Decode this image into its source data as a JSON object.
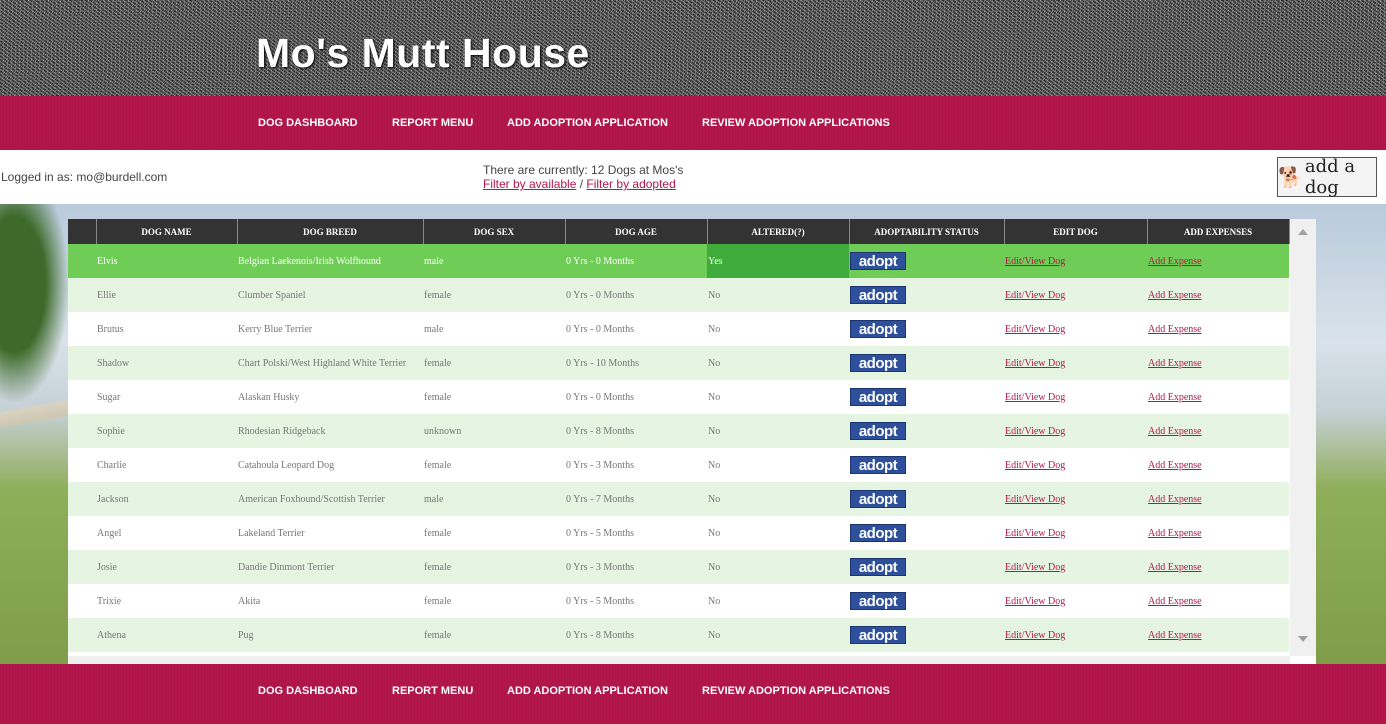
{
  "site": {
    "title": "Mo's Mutt House"
  },
  "nav": {
    "items": [
      "DOG DASHBOARD",
      "REPORT MENU",
      "ADD ADOPTION APPLICATION",
      "REVIEW ADOPTION APPLICATIONS"
    ]
  },
  "info": {
    "logged_in": "Logged in as: mo@burdell.com",
    "dog_count": "There are currently: 12 Dogs at Mos's",
    "filter_available": "Filter by available",
    "filter_separator": " / ",
    "filter_adopted": "Filter by adopted",
    "add_dog_label": "add a dog"
  },
  "table": {
    "headers": [
      "DOG NAME",
      "DOG BREED",
      "DOG SEX",
      "DOG AGE",
      "ALTERED(?)",
      "ADOPTABILITY STATUS",
      "EDIT DOG",
      "ADD EXPENSES"
    ],
    "adopt_label": "adopt",
    "edit_label": "Edit/View Dog",
    "expense_label": "Add Expense",
    "rows": [
      {
        "name": "Elvis",
        "breed": "Belgian Laekenois/Irish Wolfhound",
        "sex": "male",
        "age": "0 Yrs - 0 Months",
        "altered": "Yes"
      },
      {
        "name": "Ellie",
        "breed": "Clumber Spaniel",
        "sex": "female",
        "age": "0 Yrs - 0 Months",
        "altered": "No"
      },
      {
        "name": "Brutus",
        "breed": "Kerry Blue Terrier",
        "sex": "male",
        "age": "0 Yrs - 0 Months",
        "altered": "No"
      },
      {
        "name": "Shadow",
        "breed": "Chart Polski/West Highland White Terrier",
        "sex": "female",
        "age": "0 Yrs - 10 Months",
        "altered": "No"
      },
      {
        "name": "Sugar",
        "breed": "Alaskan Husky",
        "sex": "female",
        "age": "0 Yrs - 0 Months",
        "altered": "No"
      },
      {
        "name": "Sophie",
        "breed": "Rhodesian Ridgeback",
        "sex": "unknown",
        "age": "0 Yrs - 8 Months",
        "altered": "No"
      },
      {
        "name": "Charlie",
        "breed": "Catahoula Leopard Dog",
        "sex": "female",
        "age": "0 Yrs - 3 Months",
        "altered": "No"
      },
      {
        "name": "Jackson",
        "breed": "American Foxhound/Scottish Terrier",
        "sex": "male",
        "age": "0 Yrs - 7 Months",
        "altered": "No"
      },
      {
        "name": "Angel",
        "breed": "Lakeland Terrier",
        "sex": "female",
        "age": "0 Yrs - 5 Months",
        "altered": "No"
      },
      {
        "name": "Josie",
        "breed": "Dandie Dinmont Terrier",
        "sex": "female",
        "age": "0 Yrs - 3 Months",
        "altered": "No"
      },
      {
        "name": "Trixie",
        "breed": "Akita",
        "sex": "female",
        "age": "0 Yrs - 5 Months",
        "altered": "No"
      },
      {
        "name": "Athena",
        "breed": "Pug",
        "sex": "female",
        "age": "0 Yrs - 8 Months",
        "altered": "No"
      }
    ]
  }
}
